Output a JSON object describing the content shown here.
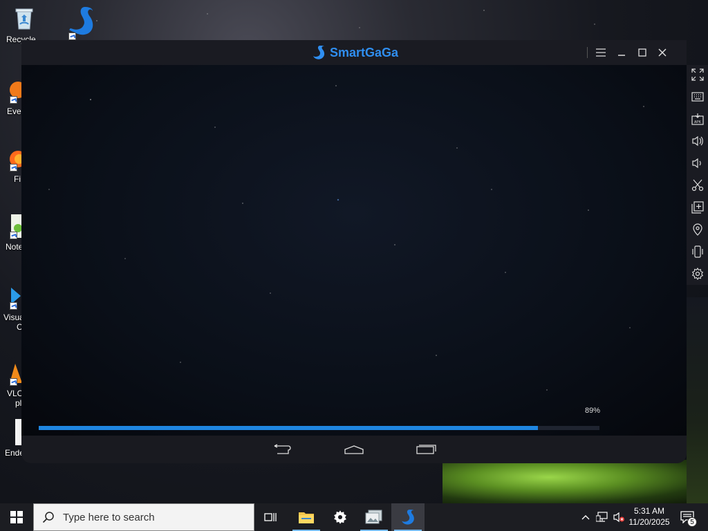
{
  "desktop": {
    "icons": [
      {
        "label": "Recycle"
      },
      {
        "label": ""
      },
      {
        "label": "Ever"
      },
      {
        "label": "Fi"
      },
      {
        "label": "Note"
      },
      {
        "label": "Visua"
      },
      {
        "label": "VLC"
      },
      {
        "label": "Enderm"
      }
    ],
    "icon_extra": {
      "visual_line2": "C",
      "vlc_line2": "pl"
    }
  },
  "window": {
    "title": "SmartGaGa",
    "accent": "#2f8ef0",
    "progress": {
      "label": "89%",
      "value": 0.89
    },
    "controls": {
      "menu": "menu-icon",
      "minimize": "minimize-icon",
      "maximize": "maximize-icon",
      "close": "close-icon"
    }
  },
  "toolbar": {
    "buttons": [
      "fullscreen-icon",
      "keyboard-icon",
      "apk-install-icon",
      "volume-up-icon",
      "volume-down-icon",
      "screenshot-cut-icon",
      "multi-instance-icon",
      "location-icon",
      "shake-icon",
      "settings-icon"
    ],
    "apk_label": "APK"
  },
  "taskbar": {
    "search_placeholder": "Type here to search",
    "clock_time": "5:31 AM",
    "clock_date": "11/20/2025",
    "notification_count": "5"
  }
}
